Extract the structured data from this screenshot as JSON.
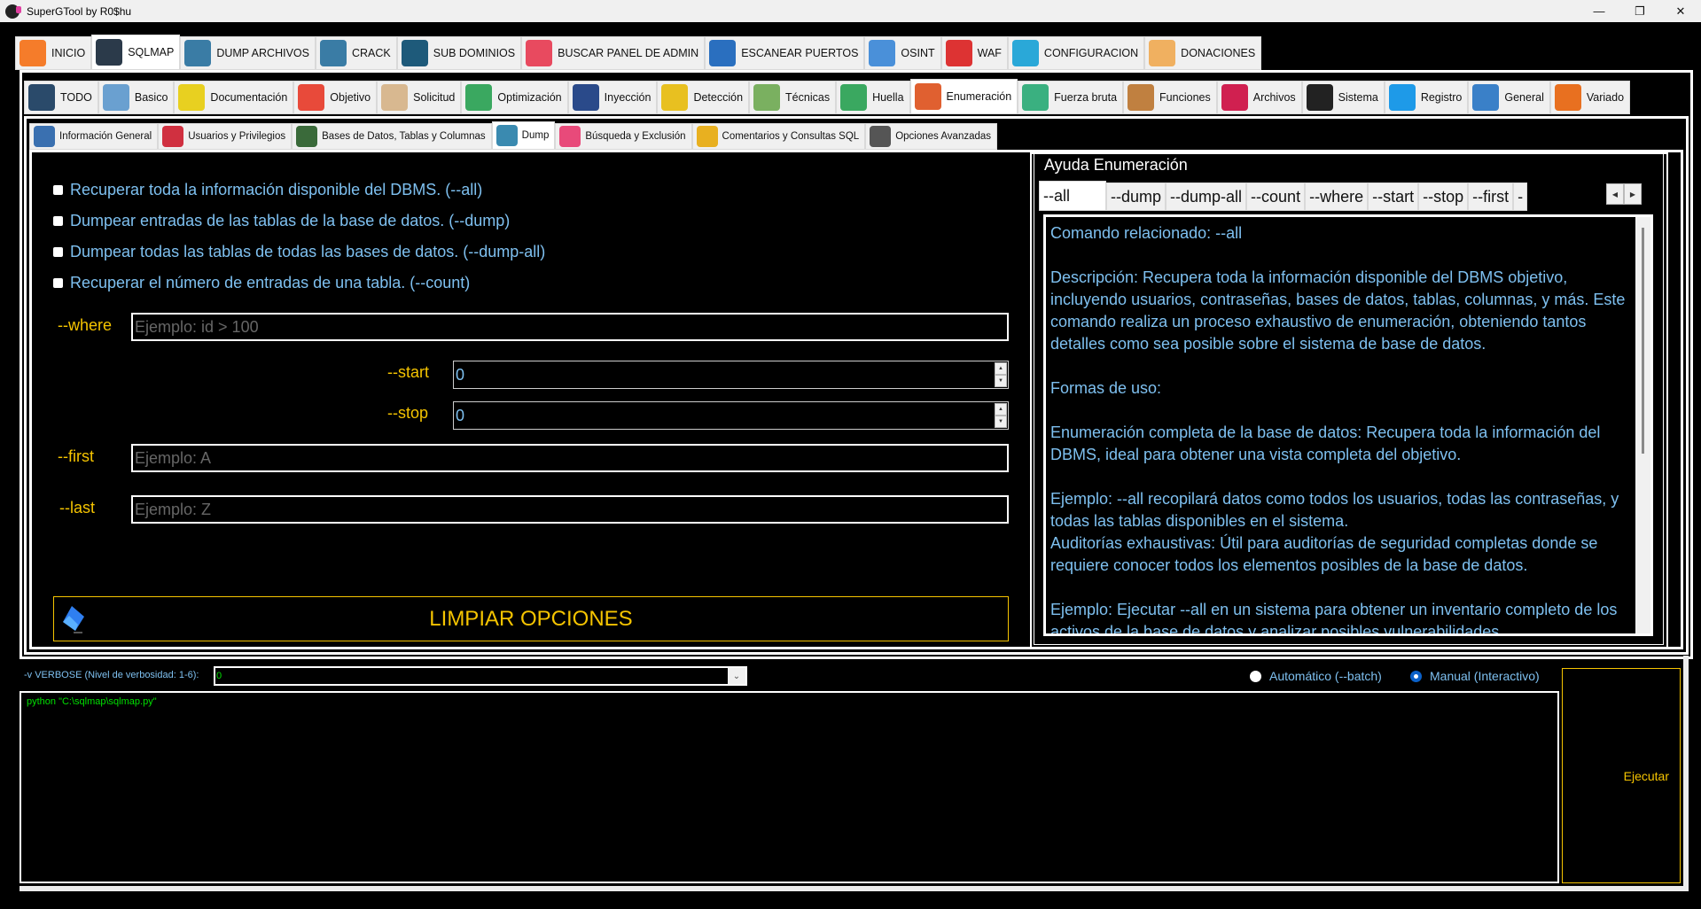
{
  "window": {
    "title": "SuperGTool by R0$hu",
    "controls": [
      "minimize",
      "restore",
      "close"
    ]
  },
  "main_tabs": [
    {
      "label": "INICIO",
      "icon": "home-icon",
      "color": "#f57c2a",
      "active": false
    },
    {
      "label": "SQLMAP",
      "icon": "terminal-icon",
      "color": "#2b3a4a",
      "active": true
    },
    {
      "label": "DUMP ARCHIVOS",
      "icon": "database-download-icon",
      "color": "#3a7ca5",
      "active": false
    },
    {
      "label": "CRACK",
      "icon": "padlock-password-icon",
      "color": "#3a7ca5",
      "active": false
    },
    {
      "label": "SUB DOMINIOS",
      "icon": "globe-network-icon",
      "color": "#1e5a7a",
      "active": false
    },
    {
      "label": "BUSCAR PANEL DE ADMIN",
      "icon": "admin-panel-icon",
      "color": "#e84a5f",
      "active": false
    },
    {
      "label": "ESCANEAR PUERTOS",
      "icon": "port-scan-globe-icon",
      "color": "#2a6fbf",
      "active": false
    },
    {
      "label": "OSINT",
      "icon": "unlocked-padlock-icon",
      "color": "#4a90d9",
      "active": false
    },
    {
      "label": "WAF",
      "icon": "firewall-shield-icon",
      "color": "#d33",
      "active": false
    },
    {
      "label": "CONFIGURACION",
      "icon": "gear-icon",
      "color": "#2aa8d8",
      "active": false
    },
    {
      "label": "DONACIONES",
      "icon": "donate-box-icon",
      "color": "#f0b060",
      "active": false
    }
  ],
  "sqlmap_tabs": [
    {
      "label": "TODO",
      "icon": "hacker-hood-icon",
      "color": "#2a4a6a",
      "active": false
    },
    {
      "label": "Basico",
      "icon": "robot-icon",
      "color": "#6aa0d0",
      "active": false
    },
    {
      "label": "Documentación",
      "icon": "sql-document-icon",
      "color": "#e8d020",
      "active": false
    },
    {
      "label": "Objetivo",
      "icon": "target-icon",
      "color": "#e84a3a",
      "active": false
    },
    {
      "label": "Solicitud",
      "icon": "request-checklist-icon",
      "color": "#d8b890",
      "active": false
    },
    {
      "label": "Optimización",
      "icon": "speedometer-icon",
      "color": "#3aa860",
      "active": false
    },
    {
      "label": "Inyección",
      "icon": "database-syringe-icon",
      "color": "#2a4a8a",
      "active": false
    },
    {
      "label": "Detección",
      "icon": "warning-magnifier-icon",
      "color": "#e8c020",
      "active": false
    },
    {
      "label": "Técnicas",
      "icon": "lightbulb-gear-icon",
      "color": "#7ab060",
      "active": false
    },
    {
      "label": "Huella",
      "icon": "fingerprint-icon",
      "color": "#3aa860",
      "active": false
    },
    {
      "label": "Enumeración",
      "icon": "server-user-icon",
      "color": "#e06030",
      "active": true
    },
    {
      "label": "Fuerza bruta",
      "icon": "binary-chat-icon",
      "color": "#3ab080",
      "active": false
    },
    {
      "label": "Funciones",
      "icon": "head-gear-icon",
      "color": "#c08040",
      "active": false
    },
    {
      "label": "Archivos",
      "icon": "root-file-icon",
      "color": "#d02050",
      "active": false
    },
    {
      "label": "Sistema",
      "icon": "linux-penguin-icon",
      "color": "#222",
      "active": false
    },
    {
      "label": "Registro",
      "icon": "windows-logo-icon",
      "color": "#1e9ae8",
      "active": false
    },
    {
      "label": "General",
      "icon": "globe-cycle-icon",
      "color": "#3a80c8",
      "active": false
    },
    {
      "label": "Variado",
      "icon": "toolbox-icon",
      "color": "#e87020",
      "active": false
    }
  ],
  "enum_tabs": [
    {
      "label": "Información General",
      "icon": "id-card-magnifier-icon",
      "color": "#3a70b0",
      "active": false
    },
    {
      "label": "Usuarios y Privilegios",
      "icon": "user-privileges-icon",
      "color": "#d03040",
      "active": false
    },
    {
      "label": "Bases de Datos, Tablas y Columnas",
      "icon": "database-tables-icon",
      "color": "#3a6a3a",
      "active": false
    },
    {
      "label": "Dump",
      "icon": "database-dump-icon",
      "color": "#3a8ab0",
      "active": true
    },
    {
      "label": "Búsqueda y Exclusión",
      "icon": "search-exclude-icon",
      "color": "#e84a7a",
      "active": false
    },
    {
      "label": "Comentarios y Consultas SQL",
      "icon": "sql-query-icon",
      "color": "#e8b020",
      "active": false
    },
    {
      "label": "Opciones Avanzadas",
      "icon": "advanced-settings-icon",
      "color": "#555",
      "active": false
    }
  ],
  "dump": {
    "checkboxes": [
      {
        "label": "Recuperar toda la información disponible del DBMS. (--all)",
        "checked": false
      },
      {
        "label": "Dumpear entradas de las tablas de la base de datos. (--dump)",
        "checked": false
      },
      {
        "label": "Dumpear todas las tablas de todas las bases de datos. (--dump-all)",
        "checked": false
      },
      {
        "label": "Recuperar el número de entradas de una tabla. (--count)",
        "checked": false
      }
    ],
    "where": {
      "label": "--where",
      "value": "",
      "placeholder": "Ejemplo: id > 100"
    },
    "start": {
      "label": "--start",
      "value": "0"
    },
    "stop": {
      "label": "--stop",
      "value": "0"
    },
    "first": {
      "label": "--first",
      "value": "",
      "placeholder": "Ejemplo: A"
    },
    "last": {
      "label": "--last",
      "value": "",
      "placeholder": "Ejemplo: Z"
    },
    "clear_button": "LIMPIAR OPCIONES"
  },
  "help": {
    "title": "Ayuda Enumeración",
    "tabs": [
      "--all",
      "--dump",
      "--dump-all",
      "--count",
      "--where",
      "--start",
      "--stop",
      "--first",
      "-"
    ],
    "active_tab": "--all",
    "text": "Comando relacionado: --all\n\nDescripción: Recupera toda la información disponible del DBMS objetivo, incluyendo usuarios, contraseñas, bases de datos, tablas, columnas, y más. Este comando realiza un proceso exhaustivo de enumeración, obteniendo tantos detalles como sea posible sobre el sistema de base de datos.\n\nFormas de uso:\n\nEnumeración completa de la base de datos: Recupera toda la información del DBMS, ideal para obtener una vista completa del objetivo.\n\nEjemplo: --all recopilará datos como todos los usuarios, todas las contraseñas, y todas las tablas disponibles en el sistema.\nAuditorías exhaustivas: Útil para auditorías de seguridad completas donde se requiere conocer todos los elementos posibles de la base de datos.\n\nEjemplo: Ejecutar --all en un sistema para obtener un inventario completo de los activos de la base de datos y analizar posibles vulnerabilidades."
  },
  "bottom": {
    "verbose_label": "-v VERBOSE (Nivel de verbosidad: 1-6):",
    "verbose_value": "0",
    "mode_options": [
      {
        "label": "Automático (--batch)",
        "selected": false
      },
      {
        "label": "Manual (Interactivo)",
        "selected": true
      }
    ],
    "command": "python \"C:\\sqlmap\\sqlmap.py\"",
    "execute_button": "Ejecutar"
  }
}
